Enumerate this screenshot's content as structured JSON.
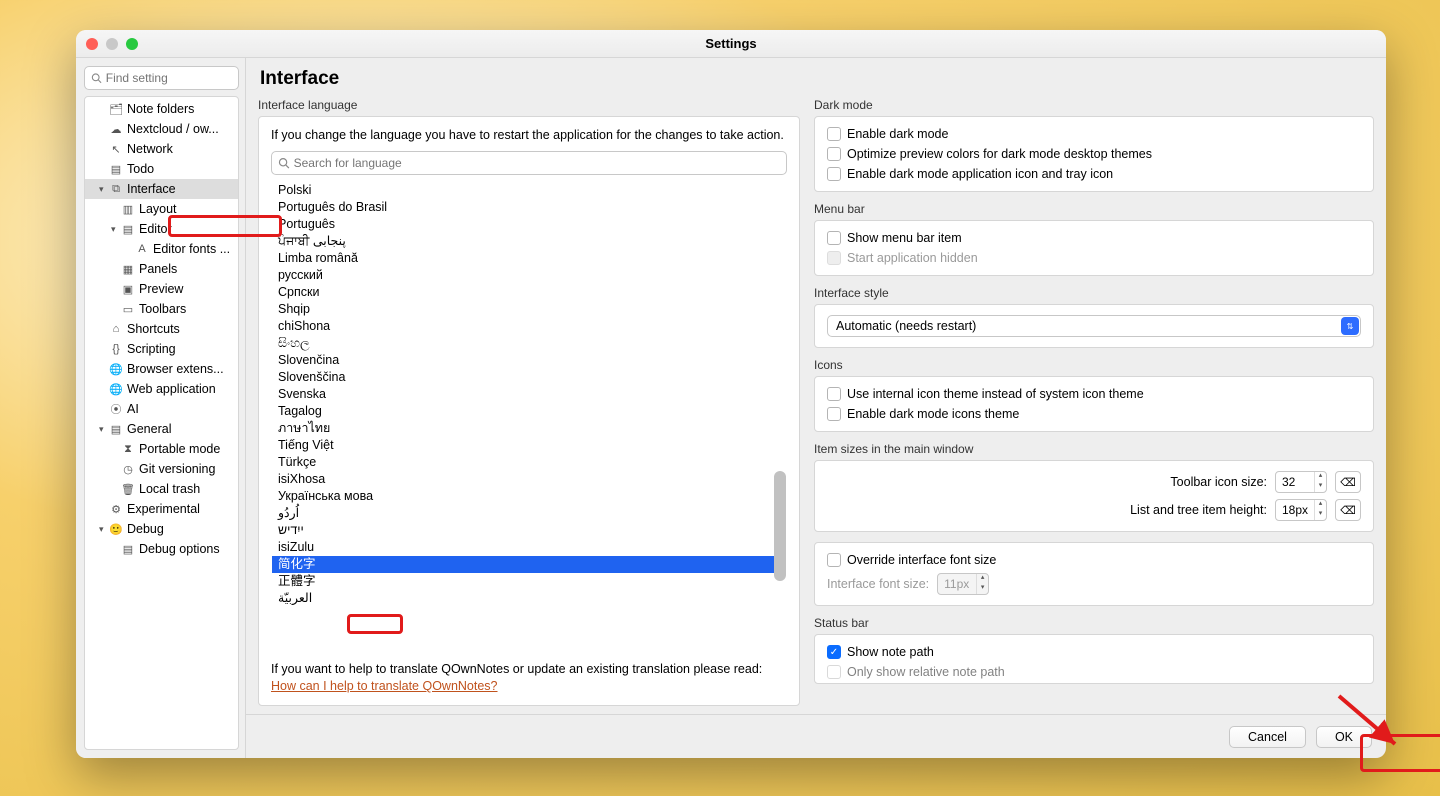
{
  "window": {
    "title": "Settings"
  },
  "sidebar": {
    "search_placeholder": "Find setting",
    "items": [
      {
        "icon": "🗂",
        "label": "Note folders",
        "indent": 0
      },
      {
        "icon": "☁︎",
        "label": "Nextcloud / ow...",
        "indent": 0
      },
      {
        "icon": "↖︎",
        "label": "Network",
        "indent": 0
      },
      {
        "icon": "▤",
        "label": "Todo",
        "indent": 0
      },
      {
        "icon": "⧉",
        "label": "Interface",
        "indent": 0,
        "sel": true,
        "disc": "▾"
      },
      {
        "icon": "▥",
        "label": "Layout",
        "indent": 1
      },
      {
        "icon": "▤",
        "label": "Editor",
        "indent": 1,
        "disc": "▾"
      },
      {
        "icon": "A",
        "label": "Editor fonts ...",
        "indent": 2
      },
      {
        "icon": "▦",
        "label": "Panels",
        "indent": 1
      },
      {
        "icon": "▣",
        "label": "Preview",
        "indent": 1
      },
      {
        "icon": "▭",
        "label": "Toolbars",
        "indent": 1
      },
      {
        "icon": "⌂",
        "label": "Shortcuts",
        "indent": 0
      },
      {
        "icon": "{}",
        "label": "Scripting",
        "indent": 0
      },
      {
        "icon": "🌐",
        "label": "Browser extens...",
        "indent": 0
      },
      {
        "icon": "🌐",
        "label": "Web application",
        "indent": 0
      },
      {
        "icon": "⦿",
        "label": "AI",
        "indent": 0
      },
      {
        "icon": "▤",
        "label": "General",
        "indent": 0,
        "disc": "▾"
      },
      {
        "icon": "⧗",
        "label": "Portable mode",
        "indent": 1
      },
      {
        "icon": "◷",
        "label": "Git versioning",
        "indent": 1
      },
      {
        "icon": "🗑",
        "label": "Local trash",
        "indent": 1
      },
      {
        "icon": "⚙︎",
        "label": "Experimental",
        "indent": 0
      },
      {
        "icon": "🙂",
        "label": "Debug",
        "indent": 0,
        "disc": "▾"
      },
      {
        "icon": "▤",
        "label": "Debug options",
        "indent": 1
      }
    ]
  },
  "main": {
    "title": "Interface",
    "lang_section_title": "Interface language",
    "lang_restart_note": "If you change the language you have to restart the application for the changes to take action.",
    "lang_search_placeholder": "Search for language",
    "languages": [
      "Polski",
      "Português do Brasil",
      "Português",
      "ਪੰਜਾਬੀ پنجابی",
      "Limba română",
      "русский",
      "Српски",
      "Shqip",
      "chiShona",
      "සිංහල",
      "Slovenčina",
      "Slovenščina",
      "Svenska",
      "Tagalog",
      "ภาษาไทย",
      "Tiếng Việt",
      "Türkçe",
      "isiXhosa",
      "Українська мова",
      "اُردُو",
      "ייִדיש",
      "isiZulu",
      "简化字",
      "正體字",
      "العربيّة"
    ],
    "lang_selected_index": 22,
    "translate_note_prefix": "If you want to help to translate QOwnNotes or update an existing translation please read: ",
    "translate_link": "How can I help to translate QOwnNotes?"
  },
  "right": {
    "dark_mode": {
      "title": "Dark mode",
      "opt1": "Enable dark mode",
      "opt2": "Optimize preview colors for dark mode desktop themes",
      "opt3": "Enable dark mode application icon and tray icon"
    },
    "menubar": {
      "title": "Menu bar",
      "opt1": "Show menu bar item",
      "opt2": "Start application hidden"
    },
    "style": {
      "title": "Interface style",
      "value": "Automatic (needs restart)"
    },
    "icons": {
      "title": "Icons",
      "opt1": "Use internal icon theme instead of system icon theme",
      "opt2": "Enable dark mode icons theme"
    },
    "sizes": {
      "title": "Item sizes in the main window",
      "toolbar_label": "Toolbar icon size:",
      "toolbar_value": "32",
      "list_label": "List and tree item height:",
      "list_value": "18px",
      "override_label": "Override interface font size",
      "fontsize_label": "Interface font size:",
      "fontsize_value": "11px"
    },
    "status": {
      "title": "Status bar",
      "opt1": "Show note path",
      "opt2": "Only show relative note path"
    }
  },
  "footer": {
    "cancel": "Cancel",
    "ok": "OK"
  }
}
